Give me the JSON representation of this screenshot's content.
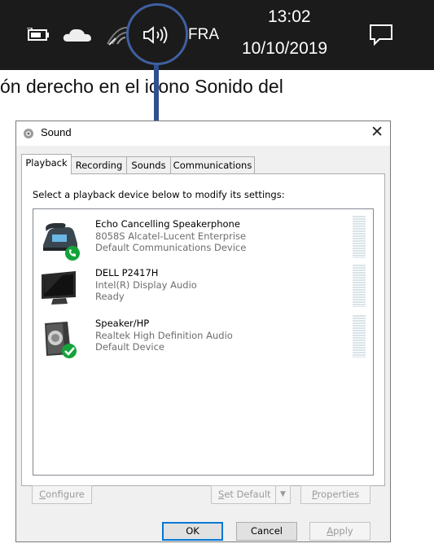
{
  "taskbar": {
    "language": "FRA",
    "time": "13:02",
    "date": "10/10/2019"
  },
  "caption": {
    "text": "ón derecho en el icono Sonido del"
  },
  "dialog": {
    "title": "Sound",
    "close": "✕",
    "tabs": [
      "Playback",
      "Recording",
      "Sounds",
      "Communications"
    ],
    "active_tab": "Playback",
    "instruction": "Select a playback device below to modify its settings:",
    "devices": [
      {
        "name": "Echo Cancelling Speakerphone",
        "line1": "8058S Alcatel-Lucent Enterprise",
        "line2": "Default Communications Device",
        "icon": "speakerphone-icon",
        "badge": "phone-badge-icon"
      },
      {
        "name": "DELL P2417H",
        "line1": "Intel(R) Display Audio",
        "line2": "Ready",
        "icon": "monitor-icon",
        "badge": ""
      },
      {
        "name": "Speaker/HP",
        "line1": "Realtek High Definition Audio",
        "line2": "Default Device",
        "icon": "speaker-icon",
        "badge": "checkmark-badge-icon"
      }
    ],
    "buttons": {
      "configure_pre": "",
      "configure_key": "C",
      "configure_rest": "onfigure",
      "set_default_key": "S",
      "set_default_rest": "et Default",
      "properties_key": "P",
      "properties_rest": "roperties",
      "ok": "OK",
      "cancel": "Cancel",
      "apply_key": "A",
      "apply_rest": "pply"
    }
  },
  "colors": {
    "taskbar": "#1b1b1b",
    "highlight": "#3f5fa0",
    "green_badge": "#14a33a",
    "focus_blue": "#0078d7"
  }
}
